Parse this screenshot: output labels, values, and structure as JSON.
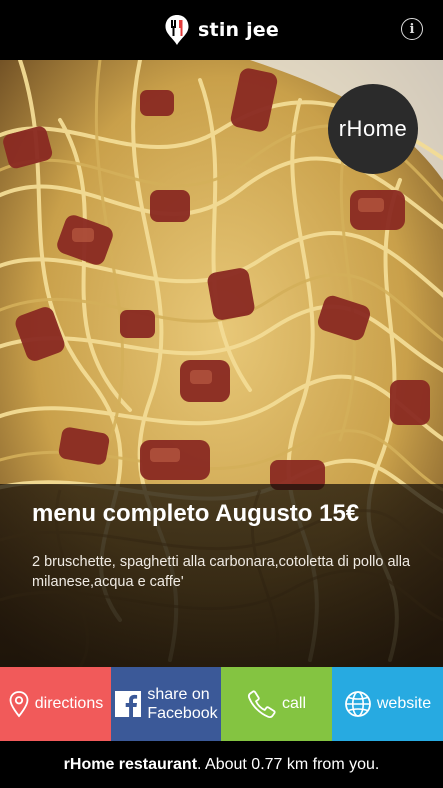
{
  "header": {
    "brand_name": "stin jee",
    "info_icon": "info-icon",
    "info_glyph": "i"
  },
  "hero": {
    "image_subject": "spaghetti-carbonara-photo",
    "restaurant_badge": "rHome"
  },
  "offer": {
    "title": "menu completo Augusto 15€",
    "description": "2 bruschette, spaghetti alla carbonara,cotoletta di pollo alla milanese,acqua e caffe'"
  },
  "actions": [
    {
      "id": "directions",
      "label": "directions",
      "icon": "location-pin-icon",
      "color": "#f15a5a"
    },
    {
      "id": "facebook",
      "label_line1": "share on",
      "label_line2": "Facebook",
      "icon": "facebook-icon",
      "color": "#3b5998"
    },
    {
      "id": "call",
      "label": "call",
      "icon": "phone-icon",
      "color": "#84c441"
    },
    {
      "id": "website",
      "label": "website",
      "icon": "globe-icon",
      "color": "#27aae1"
    }
  ],
  "footer": {
    "restaurant_name": "rHome restaurant",
    "distance_text": ". About 0.77 km from you."
  }
}
